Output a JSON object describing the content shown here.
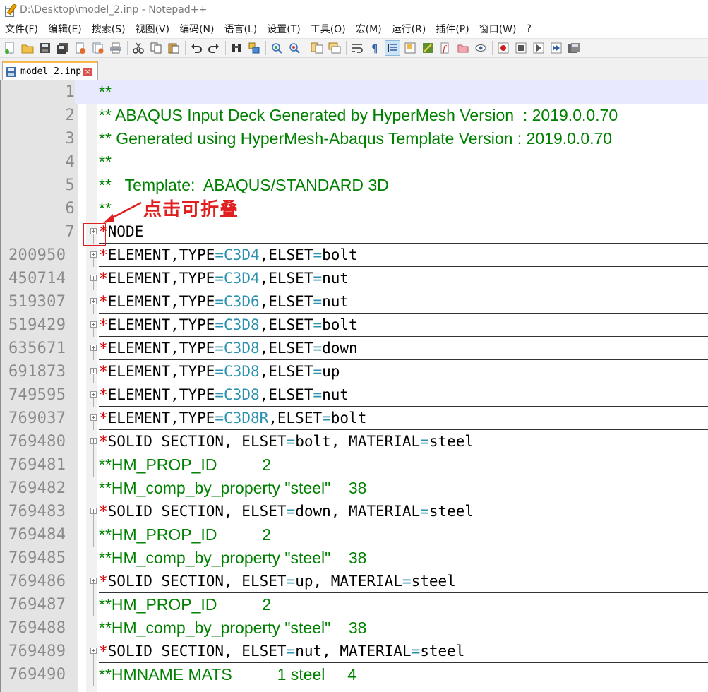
{
  "window": {
    "title": "D:\\Desktop\\model_2.inp - Notepad++"
  },
  "menu": [
    "文件(F)",
    "编辑(E)",
    "搜索(S)",
    "视图(V)",
    "编码(N)",
    "语言(L)",
    "设置(T)",
    "工具(O)",
    "宏(M)",
    "运行(R)",
    "插件(P)",
    "窗口(W)",
    "?"
  ],
  "tab": {
    "label": "model_2.inp",
    "close": "×"
  },
  "annotation": {
    "text": "点击可折叠",
    "color": "#e02020"
  },
  "colors": {
    "comment": "#008000",
    "keyword_star": "#d40000",
    "assignment": "#2b91af",
    "current_line": "#e8e8ff"
  },
  "lines": [
    {
      "num": "1",
      "type": "comment",
      "text": "**"
    },
    {
      "num": "2",
      "type": "comment",
      "text": "** ABAQUS Input Deck Generated by HyperMesh Version  : 2019.0.0.70"
    },
    {
      "num": "3",
      "type": "comment",
      "text": "** Generated using HyperMesh-Abaqus Template Version : 2019.0.0.70"
    },
    {
      "num": "4",
      "type": "comment",
      "text": "**"
    },
    {
      "num": "5",
      "type": "comment",
      "text": "**   Template:  ABAQUS/STANDARD 3D"
    },
    {
      "num": "6",
      "type": "comment",
      "text": "**"
    },
    {
      "num": "7",
      "type": "keyword",
      "parts": [
        [
          "star",
          "*"
        ],
        [
          "kw",
          "NODE"
        ]
      ],
      "fold": true
    },
    {
      "num": "200950",
      "type": "keyword",
      "parts": [
        [
          "star",
          "*"
        ],
        [
          "kw",
          "ELEMENT,TYPE"
        ],
        [
          "as",
          "="
        ],
        [
          "val",
          "C3D4"
        ],
        [
          "kw",
          ",ELSET"
        ],
        [
          "as",
          "="
        ],
        [
          "kw",
          "bolt"
        ]
      ],
      "fold": true
    },
    {
      "num": "450714",
      "type": "keyword",
      "parts": [
        [
          "star",
          "*"
        ],
        [
          "kw",
          "ELEMENT,TYPE"
        ],
        [
          "as",
          "="
        ],
        [
          "val",
          "C3D4"
        ],
        [
          "kw",
          ",ELSET"
        ],
        [
          "as",
          "="
        ],
        [
          "kw",
          "nut"
        ]
      ],
      "fold": true
    },
    {
      "num": "519307",
      "type": "keyword",
      "parts": [
        [
          "star",
          "*"
        ],
        [
          "kw",
          "ELEMENT,TYPE"
        ],
        [
          "as",
          "="
        ],
        [
          "val",
          "C3D6"
        ],
        [
          "kw",
          ",ELSET"
        ],
        [
          "as",
          "="
        ],
        [
          "kw",
          "nut"
        ]
      ],
      "fold": true
    },
    {
      "num": "519429",
      "type": "keyword",
      "parts": [
        [
          "star",
          "*"
        ],
        [
          "kw",
          "ELEMENT,TYPE"
        ],
        [
          "as",
          "="
        ],
        [
          "val",
          "C3D8"
        ],
        [
          "kw",
          ",ELSET"
        ],
        [
          "as",
          "="
        ],
        [
          "kw",
          "bolt"
        ]
      ],
      "fold": true
    },
    {
      "num": "635671",
      "type": "keyword",
      "parts": [
        [
          "star",
          "*"
        ],
        [
          "kw",
          "ELEMENT,TYPE"
        ],
        [
          "as",
          "="
        ],
        [
          "val",
          "C3D8"
        ],
        [
          "kw",
          ",ELSET"
        ],
        [
          "as",
          "="
        ],
        [
          "kw",
          "down"
        ]
      ],
      "fold": true
    },
    {
      "num": "691873",
      "type": "keyword",
      "parts": [
        [
          "star",
          "*"
        ],
        [
          "kw",
          "ELEMENT,TYPE"
        ],
        [
          "as",
          "="
        ],
        [
          "val",
          "C3D8"
        ],
        [
          "kw",
          ",ELSET"
        ],
        [
          "as",
          "="
        ],
        [
          "kw",
          "up"
        ]
      ],
      "fold": true
    },
    {
      "num": "749595",
      "type": "keyword",
      "parts": [
        [
          "star",
          "*"
        ],
        [
          "kw",
          "ELEMENT,TYPE"
        ],
        [
          "as",
          "="
        ],
        [
          "val",
          "C3D8"
        ],
        [
          "kw",
          ",ELSET"
        ],
        [
          "as",
          "="
        ],
        [
          "kw",
          "nut"
        ]
      ],
      "fold": true
    },
    {
      "num": "769037",
      "type": "keyword",
      "parts": [
        [
          "star",
          "*"
        ],
        [
          "kw",
          "ELEMENT,TYPE"
        ],
        [
          "as",
          "="
        ],
        [
          "val",
          "C3D8R"
        ],
        [
          "kw",
          ",ELSET"
        ],
        [
          "as",
          "="
        ],
        [
          "kw",
          "bolt"
        ]
      ],
      "fold": true
    },
    {
      "num": "769480",
      "type": "keyword",
      "parts": [
        [
          "star",
          "*"
        ],
        [
          "kw",
          "SOLID SECTION, ELSET"
        ],
        [
          "as",
          "="
        ],
        [
          "kw",
          "bolt, MATERIAL"
        ],
        [
          "as",
          "="
        ],
        [
          "kw",
          "steel"
        ]
      ],
      "fold": true
    },
    {
      "num": "769481",
      "type": "comment",
      "text": "**HM_PROP_ID          2"
    },
    {
      "num": "769482",
      "type": "comment",
      "text": "**HM_comp_by_property \"steel\"    38"
    },
    {
      "num": "769483",
      "type": "keyword",
      "parts": [
        [
          "star",
          "*"
        ],
        [
          "kw",
          "SOLID SECTION, ELSET"
        ],
        [
          "as",
          "="
        ],
        [
          "kw",
          "down, MATERIAL"
        ],
        [
          "as",
          "="
        ],
        [
          "kw",
          "steel"
        ]
      ],
      "fold": true
    },
    {
      "num": "769484",
      "type": "comment",
      "text": "**HM_PROP_ID          2"
    },
    {
      "num": "769485",
      "type": "comment",
      "text": "**HM_comp_by_property \"steel\"    38"
    },
    {
      "num": "769486",
      "type": "keyword",
      "parts": [
        [
          "star",
          "*"
        ],
        [
          "kw",
          "SOLID SECTION, ELSET"
        ],
        [
          "as",
          "="
        ],
        [
          "kw",
          "up, MATERIAL"
        ],
        [
          "as",
          "="
        ],
        [
          "kw",
          "steel"
        ]
      ],
      "fold": true
    },
    {
      "num": "769487",
      "type": "comment",
      "text": "**HM_PROP_ID          2"
    },
    {
      "num": "769488",
      "type": "comment",
      "text": "**HM_comp_by_property \"steel\"    38"
    },
    {
      "num": "769489",
      "type": "keyword",
      "parts": [
        [
          "star",
          "*"
        ],
        [
          "kw",
          "SOLID SECTION, ELSET"
        ],
        [
          "as",
          "="
        ],
        [
          "kw",
          "nut, MATERIAL"
        ],
        [
          "as",
          "="
        ],
        [
          "kw",
          "steel"
        ]
      ],
      "fold": true
    },
    {
      "num": "769490",
      "type": "comment",
      "text": "**HMNAME MATS          1 steel     4"
    }
  ]
}
